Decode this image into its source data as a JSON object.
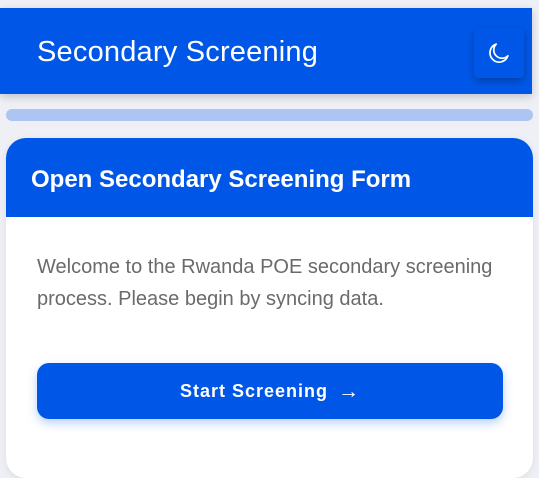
{
  "header": {
    "title": "Secondary Screening",
    "theme_toggle_icon": "moon-icon"
  },
  "progress": {
    "value_percent": 0,
    "color": "#0057e7",
    "track_color": "#adc5f2"
  },
  "card": {
    "title": "Open Secondary Screening Form",
    "message": "Welcome to the Rwanda POE secondary screening process. Please begin by syncing data.",
    "button_label": "Start Screening",
    "button_icon": "arrow-right-icon",
    "button_arrow": "→"
  },
  "colors": {
    "primary": "#0057e7",
    "background": "#eef0f6",
    "card_background": "#ffffff",
    "body_text": "#6a6a6a"
  }
}
